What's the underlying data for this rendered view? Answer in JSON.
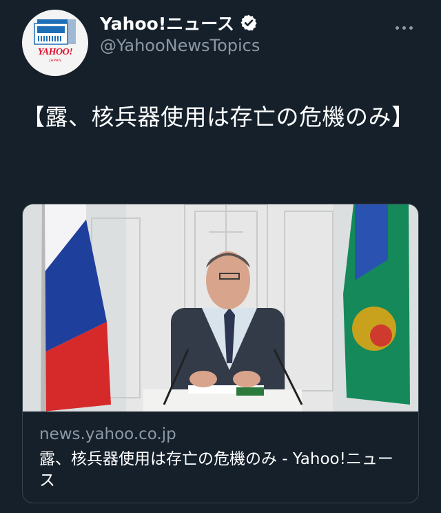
{
  "account": {
    "display_name": "Yahoo!ニュース",
    "handle": "@YahooNewsTopics",
    "verified": true,
    "avatar_logo_text": "YAHOO!",
    "avatar_logo_sub": "JAPAN"
  },
  "tweet": {
    "text": "【露、核兵器使用は存亡の危機のみ】"
  },
  "link_card": {
    "domain": "news.yahoo.co.jp",
    "title": "露、核兵器使用は存亡の危機のみ - Yahoo!ニュース"
  },
  "icons": [
    "verified-badge-icon",
    "more-options-icon",
    "newspaper-icon"
  ],
  "colors": {
    "background": "#15202b",
    "secondary_text": "#8b98a5",
    "card_border": "#38444d",
    "yahoo_red": "#e0102e",
    "avatar_blue": "#1d6fb8"
  }
}
